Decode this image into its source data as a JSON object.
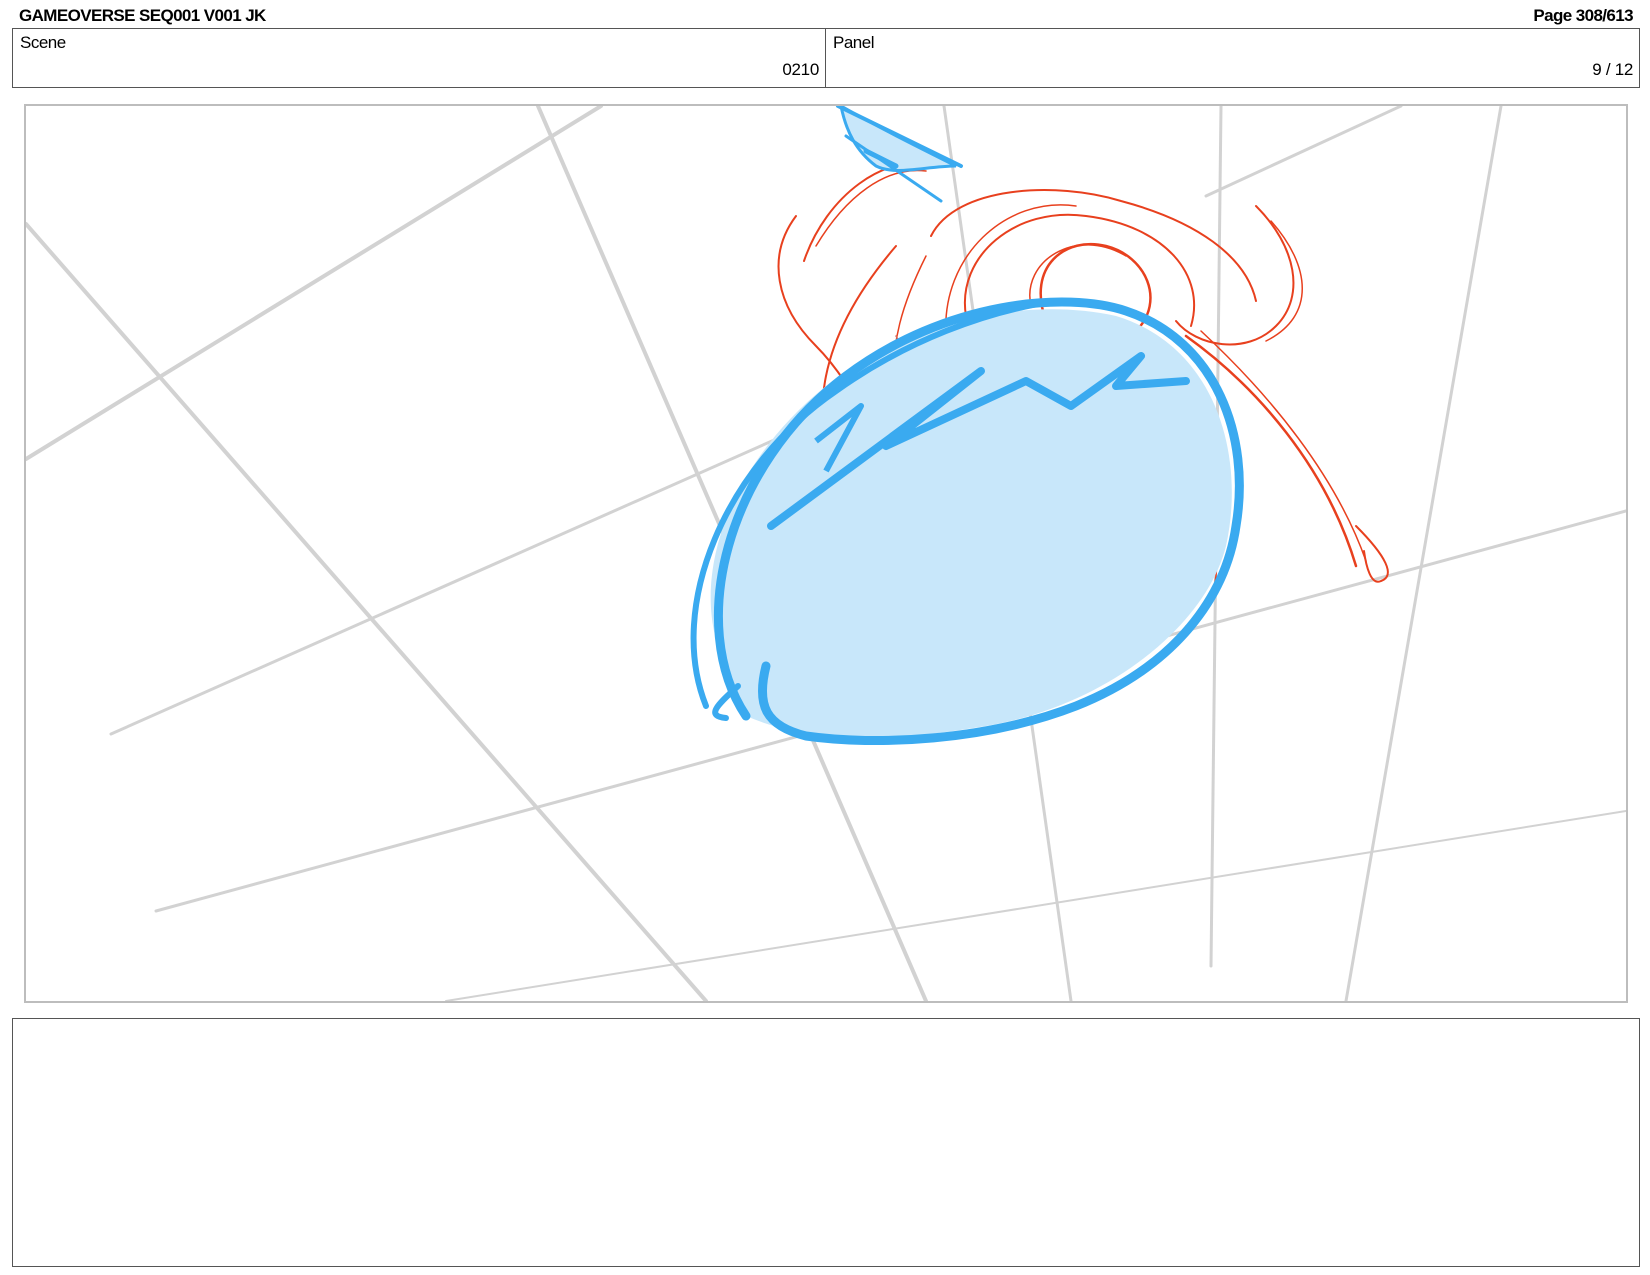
{
  "header": {
    "title": "GAMEOVERSE SEQ001 V001 JK",
    "page": "Page 308/613"
  },
  "info": {
    "scene_label": "Scene",
    "scene_value": "0210",
    "panel_label": "Panel",
    "panel_value": "9 / 12"
  },
  "colors": {
    "grid": "#d2d2d2",
    "sketch_red": "#e8401e",
    "sketch_blue": "#3aaaf0",
    "sketch_blue_fill": "#c8e7fa"
  },
  "notes": ""
}
